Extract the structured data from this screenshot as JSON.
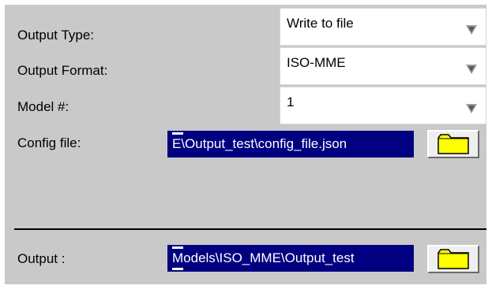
{
  "output_type": {
    "label": "Output Type:",
    "value": "Write to file"
  },
  "output_format": {
    "label": "Output Format:",
    "value": "ISO-MME"
  },
  "model_number": {
    "label": "Model #:",
    "value": "1"
  },
  "config_file": {
    "label": "Config file:",
    "value": "E\\Output_test\\config_file.json"
  },
  "output": {
    "label": "Output :",
    "value": "Models\\ISO_MME\\Output_test"
  },
  "icons": {
    "dropdown": "chevron-down-icon",
    "browse": "folder-icon"
  },
  "colors": {
    "panel_background": "#c9c9c9",
    "selected_field_background": "#000080",
    "folder_icon": "#ffff00"
  }
}
